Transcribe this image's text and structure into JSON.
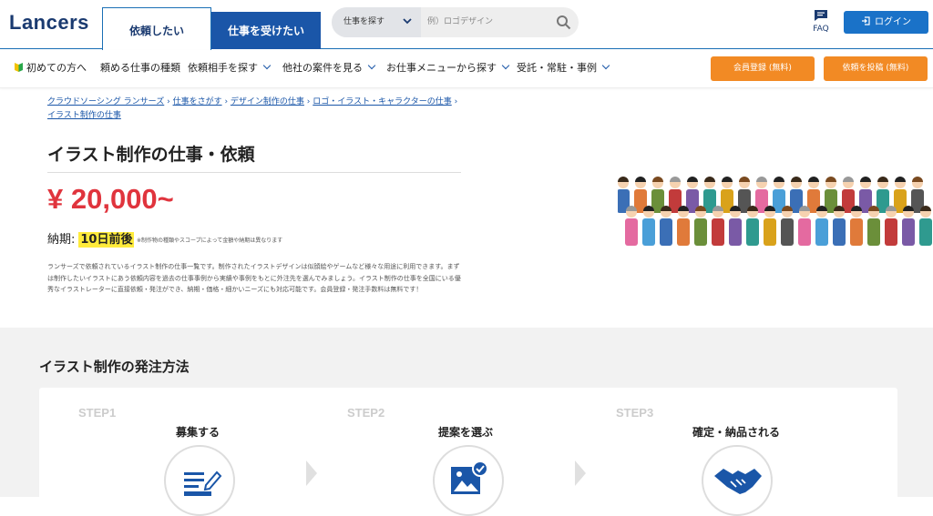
{
  "header": {
    "logo": "Lancers",
    "tab_request": "依頼したい",
    "tab_work": "仕事を受けたい",
    "search_select": "仕事を探す",
    "search_placeholder": "例）ロゴデザイン",
    "faq": "FAQ",
    "login": "ログイン"
  },
  "nav": {
    "items": [
      "初めての方へ",
      "頼める仕事の種類",
      "依頼相手を探す",
      "他社の案件を見る",
      "お仕事メニューから探す",
      "受託・常駐・事例"
    ],
    "register": "会員登録 (無料)",
    "post": "依頼を投稿 (無料)"
  },
  "breadcrumb": [
    "クラウドソーシング ランサーズ",
    "仕事をさがす",
    "デザイン制作の仕事",
    "ロゴ・イラスト・キャラクターの仕事",
    "イラスト制作の仕事"
  ],
  "page": {
    "title": "イラスト制作の仕事・依頼",
    "price": "¥ 20,000~",
    "deadline_label": "納期:",
    "deadline_value": "10日前後",
    "deadline_note": "※制作物の種類やスコープによって金額や納期は異なります",
    "description": "ランサーズで依頼されているイラスト制作の仕事一覧です。制作されたイラストデザインは似顔絵やゲームなど様々な用途に利用できます。まずは制作したいイラストにあう依頼内容を過去の仕事事例から実績や事例をもとに外注先を選んでみましょう。イラスト制作の仕事を全国にいる優秀なイラストレーターに直接依頼・発注ができ、納期・価格・細かいニーズにも対応可能です。会員登録・発注手数料は無料です！"
  },
  "process": {
    "heading": "イラスト制作の発注方法",
    "steps": [
      {
        "label": "STEP1",
        "title": "募集する",
        "icon": "document-pen-icon"
      },
      {
        "label": "STEP2",
        "title": "提案を選ぶ",
        "icon": "image-check-icon"
      },
      {
        "label": "STEP3",
        "title": "確定・納品される",
        "icon": "handshake-icon"
      }
    ]
  },
  "colors": {
    "brand": "#1a56a8",
    "orange": "#f28a24",
    "price": "#e0343d"
  }
}
